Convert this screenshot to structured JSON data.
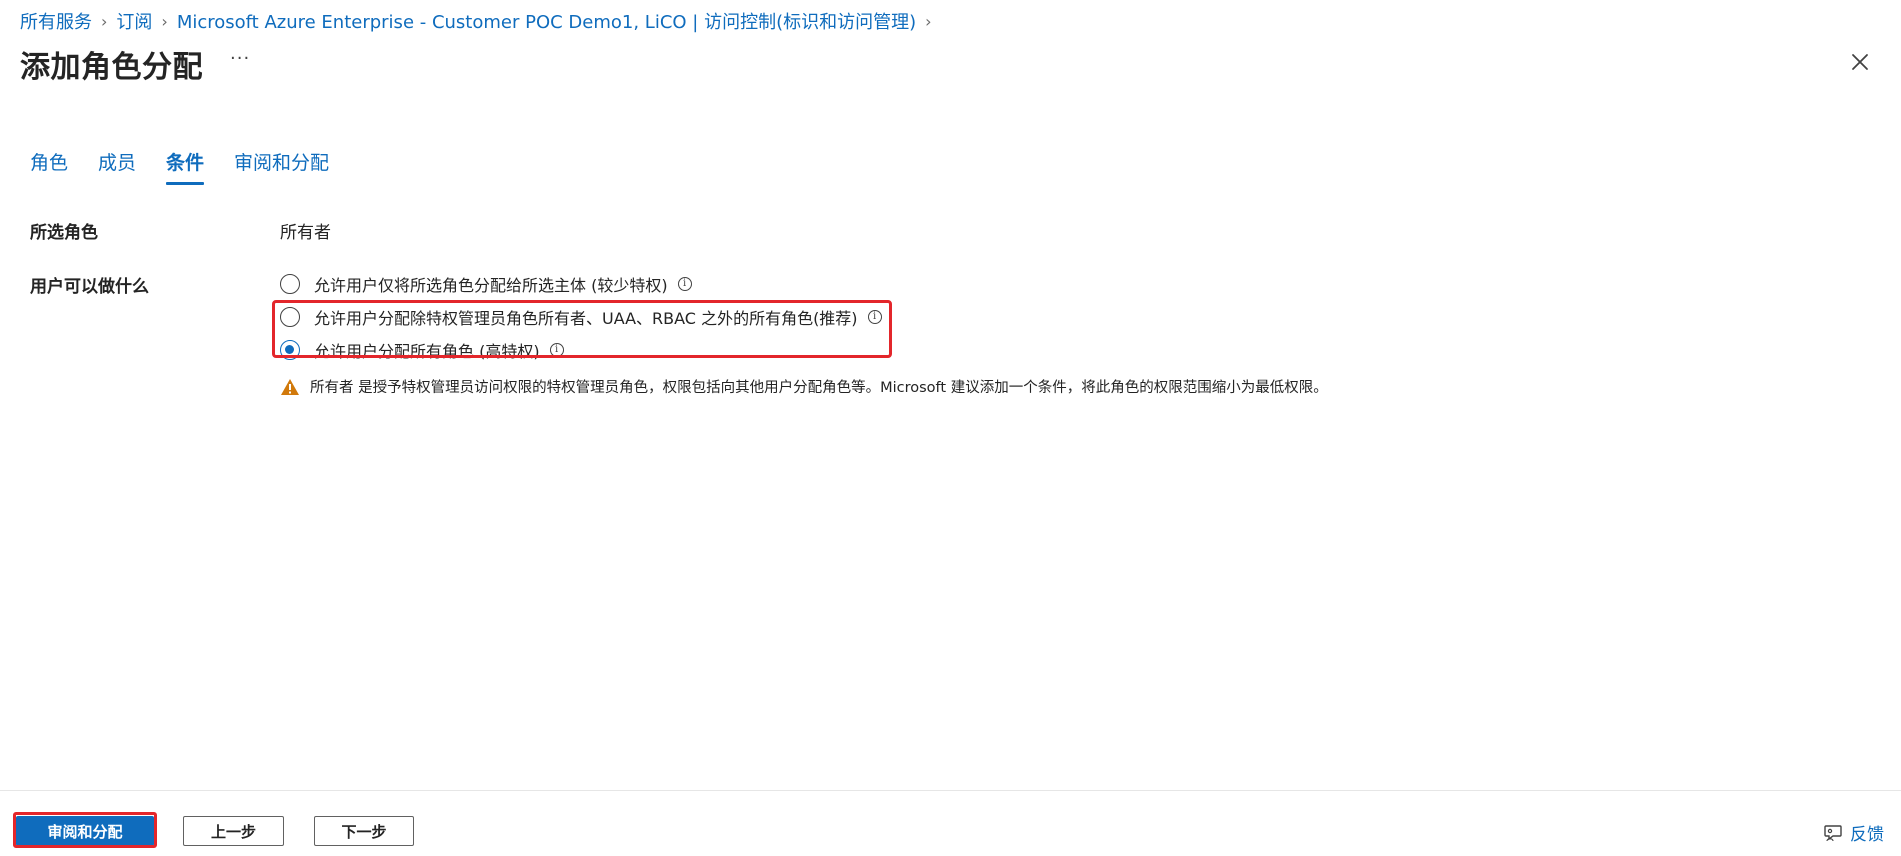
{
  "breadcrumb": [
    "所有服务",
    "订阅",
    "Microsoft Azure Enterprise - Customer POC Demo1, LiCO | 访问控制(标识和访问管理)"
  ],
  "page_title": "添加角色分配",
  "more_label": "···",
  "tabs": [
    {
      "label": "角色",
      "active": false
    },
    {
      "label": "成员",
      "active": false
    },
    {
      "label": "条件",
      "active": true
    },
    {
      "label": "审阅和分配",
      "active": false
    }
  ],
  "form": {
    "selected_role_label": "所选角色",
    "selected_role_value": "所有者",
    "user_can_do_label": "用户可以做什么",
    "options": [
      {
        "label": "允许用户仅将所选角色分配给所选主体 (较少特权)",
        "checked": false
      },
      {
        "label": "允许用户分配除特权管理员角色所有者、UAA、RBAC 之外的所有角色(推荐)",
        "checked": false
      },
      {
        "label": "允许用户分配所有角色 (高特权)",
        "checked": true
      }
    ],
    "info_glyph": "i",
    "warning_text": "所有者 是授予特权管理员访问权限的特权管理员角色，权限包括向其他用户分配角色等。Microsoft 建议添加一个条件，将此角色的权限范围缩小为最低权限。"
  },
  "footer": {
    "review_assign": "审阅和分配",
    "prev": "上一步",
    "next": "下一步",
    "feedback": "反馈"
  },
  "colors": {
    "accent": "#0f6cbd",
    "highlight": "#e3262b",
    "warning": "#d1790b"
  }
}
